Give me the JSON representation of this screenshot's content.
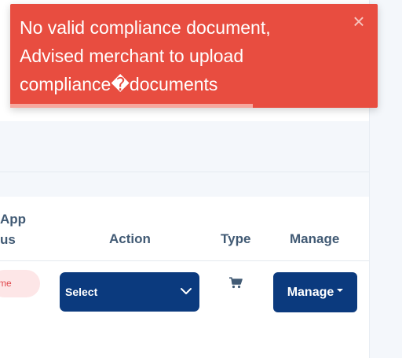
{
  "toast": {
    "message_lines": [
      "No valid compliance document,",
      "Advised merchant to upload",
      "compliance�documents"
    ],
    "close_glyph": "×",
    "progress": 0.66,
    "color": "#e84d40"
  },
  "table": {
    "headers": {
      "app_status_line1": "App",
      "app_status_line2": "us",
      "action": "Action",
      "type": "Type",
      "manage": "Manage"
    },
    "row": {
      "status_badge": "me",
      "action_select_value": "Select",
      "type_icon": "cart-icon",
      "manage_label": "Manage"
    }
  },
  "colors": {
    "primary_button": "#0b3a7e",
    "header_text": "#415a74",
    "status_badge_bg": "#fde6e7",
    "status_badge_text": "#e0474c"
  }
}
